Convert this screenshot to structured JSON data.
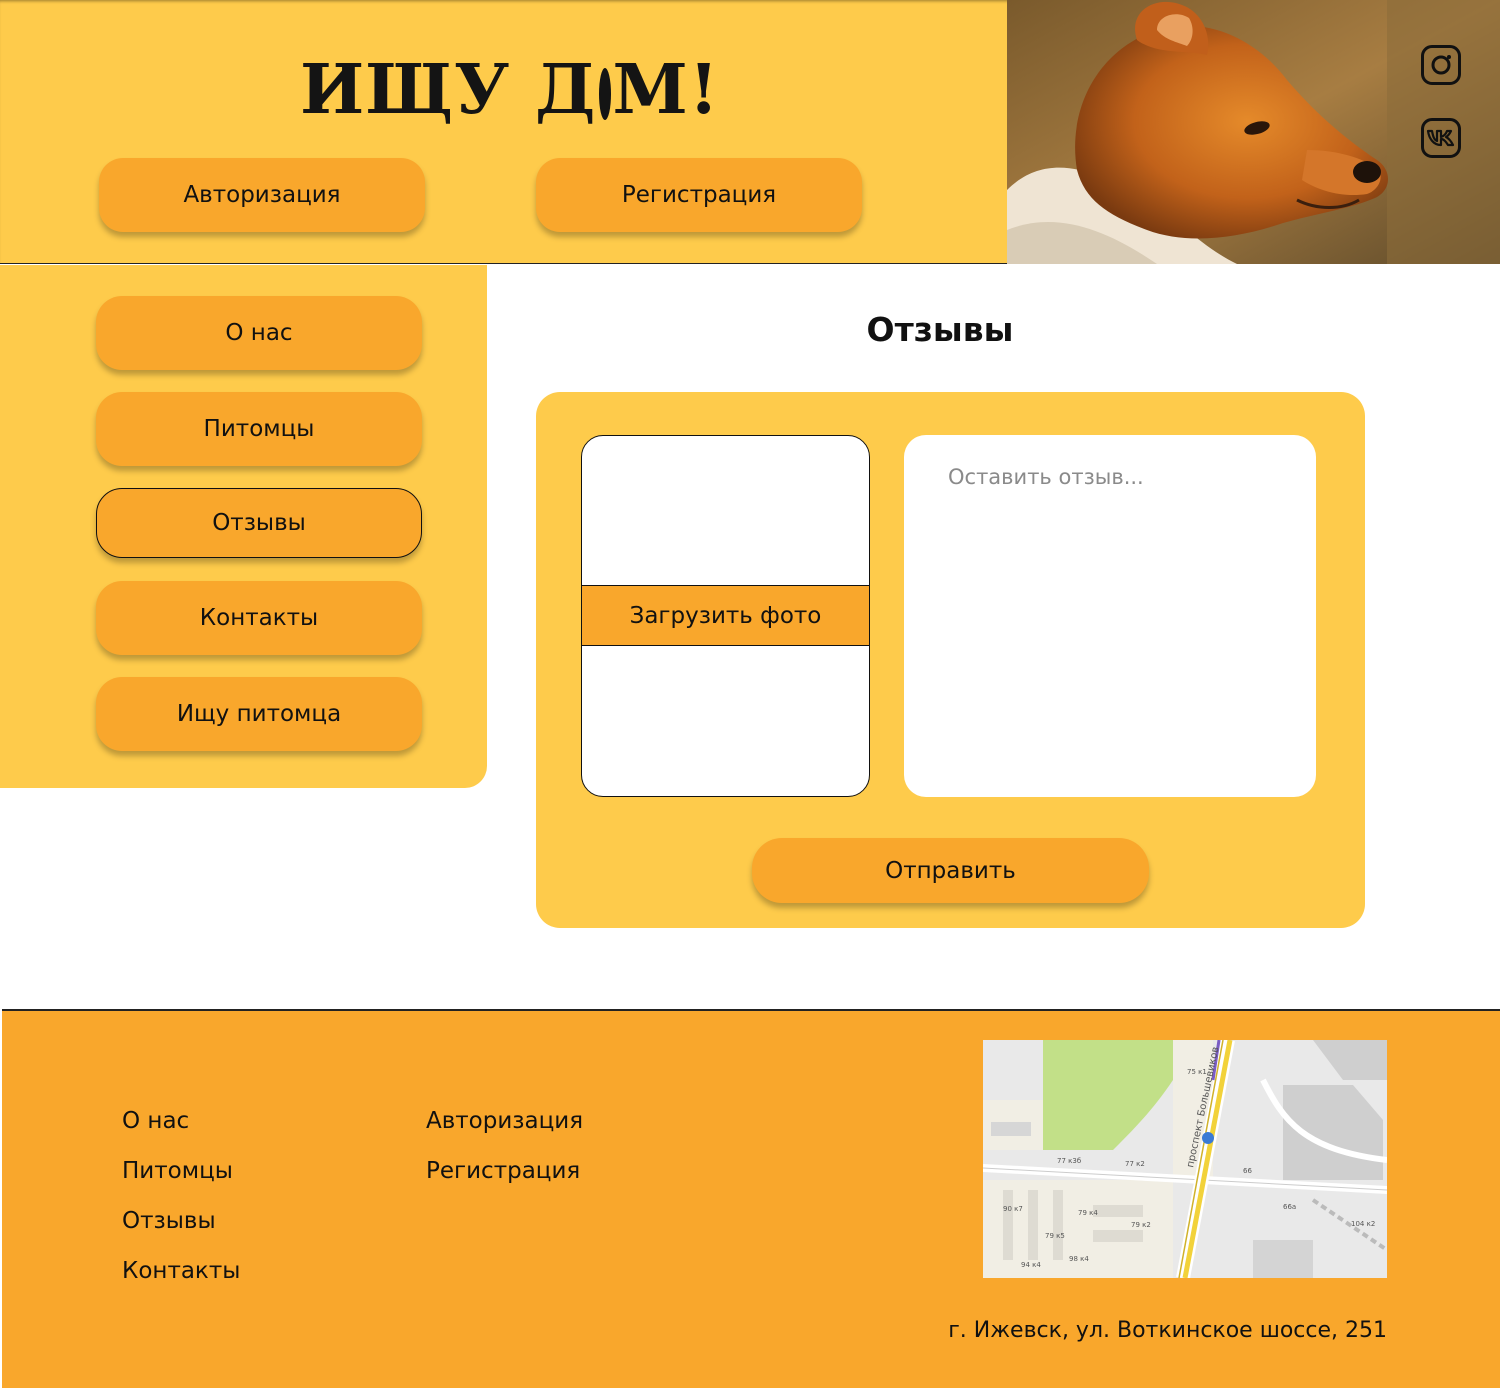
{
  "header": {
    "logo_text_1": "ИЩУ Д",
    "logo_text_2": "М!",
    "login_label": "Авторизация",
    "register_label": "Регистрация",
    "social": [
      "instagram-icon",
      "vk-icon"
    ]
  },
  "sidebar": {
    "items": [
      {
        "label": "О нас"
      },
      {
        "label": "Питомцы"
      },
      {
        "label": "Отзывы"
      },
      {
        "label": "Контакты"
      },
      {
        "label": "Ищу питомца"
      }
    ],
    "active_index": 2
  },
  "main": {
    "title": "Отзывы",
    "upload_label": "Загрузить фото",
    "review_placeholder": "Оставить отзыв...",
    "review_value": "",
    "submit_label": "Отправить"
  },
  "footer": {
    "col1": [
      "О нас",
      "Питомцы",
      "Отзывы",
      "Контакты"
    ],
    "col2": [
      "Авторизация",
      "Регистрация"
    ],
    "address": "г. Ижевск, ул. Воткинское шоссе, 251",
    "map": {
      "street_label": "проспект Большевиков",
      "labels": [
        "75 к1",
        "77 к3б",
        "77 к2",
        "66",
        "90 к7",
        "79 к4",
        "66а",
        "79 к2",
        "79 к5",
        "104 к2",
        "98 к4",
        "94 к4"
      ]
    }
  },
  "colors": {
    "header_bg": "#FECB4B",
    "button": "#F9A72C",
    "footer_bg": "#F9A72C"
  }
}
